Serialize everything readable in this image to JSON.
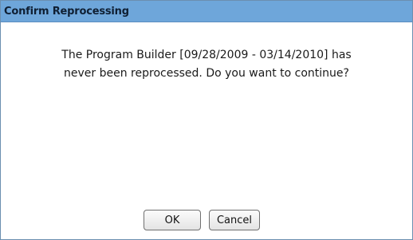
{
  "dialog": {
    "title": "Confirm Reprocessing",
    "message_line1": "The Program Builder [09/28/2009 - 03/14/2010] has",
    "message_line2": "never been reprocessed. Do you want to continue?",
    "ok_label": "OK",
    "cancel_label": "Cancel"
  },
  "colors": {
    "titlebar": "#6ea6da",
    "border": "#6b8fb0"
  }
}
